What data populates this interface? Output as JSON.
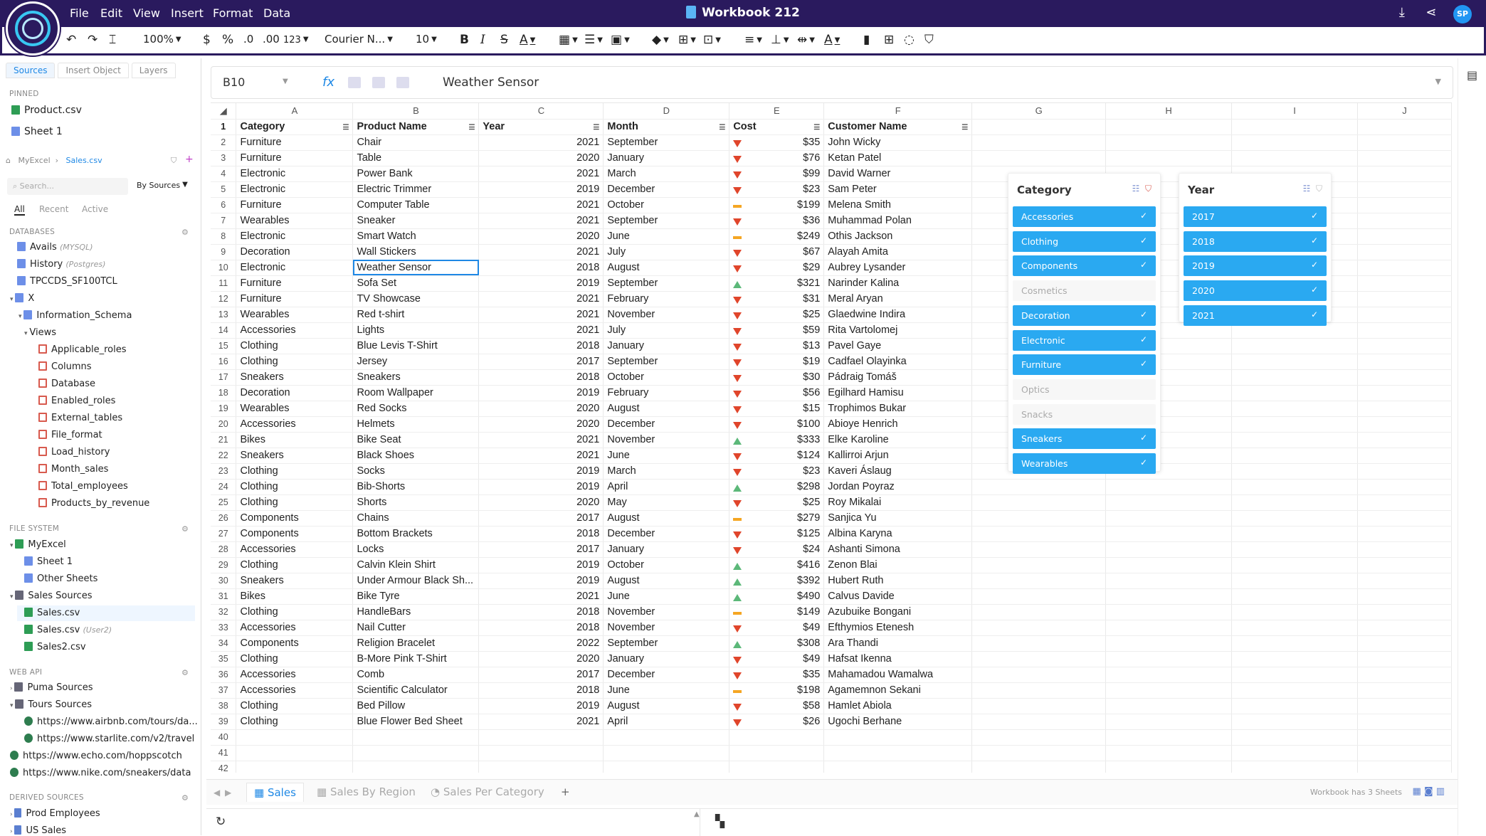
{
  "app": {
    "title": "Workbook 212",
    "menu": [
      "File",
      "Edit",
      "View",
      "Insert",
      "Format",
      "Data"
    ],
    "avatar_initials": "SP"
  },
  "toolbar": {
    "zoom": "100%",
    "currency": "$",
    "percent": "%",
    "dec_decrease": ".0",
    "dec_increase": ".00",
    "number_format": "123",
    "font": "Courier N...",
    "font_size": "10",
    "bold": "B",
    "italic": "I",
    "strike": "S",
    "text_color": "A",
    "font_color2": "A"
  },
  "sidebar": {
    "tabs": [
      "Sources",
      "Insert Object",
      "Layers"
    ],
    "pinned_label": "PINNED",
    "pinned": [
      "Product.csv",
      "Sheet 1"
    ],
    "breadcrumb": [
      "MyExcel",
      "Sales.csv"
    ],
    "search_placeholder": "Search...",
    "by_sources": "By Sources",
    "filter_tabs": [
      "All",
      "Recent",
      "Active"
    ],
    "databases_label": "DATABASES",
    "databases": [
      {
        "name": "Avails",
        "note": "(MYSQL)"
      },
      {
        "name": "History",
        "note": "(Postgres)"
      },
      {
        "name": "TPCCDS_SF100TCL",
        "note": ""
      },
      {
        "name": "X",
        "note": ""
      }
    ],
    "schema": "Information_Schema",
    "views_label": "Views",
    "views": [
      "Applicable_roles",
      "Columns",
      "Database",
      "Enabled_roles",
      "External_tables",
      "File_format",
      "Load_history",
      "Month_sales",
      "Total_employees",
      "Products_by_revenue"
    ],
    "file_system_label": "FILE SYSTEM",
    "file_system": {
      "root": "MyExcel",
      "children": [
        "Sheet 1",
        "Other Sheets"
      ],
      "folder": "Sales Sources",
      "files": [
        {
          "name": "Sales.csv",
          "note": ""
        },
        {
          "name": "Sales.csv",
          "note": "(User2)"
        },
        {
          "name": "Sales2.csv",
          "note": ""
        }
      ]
    },
    "web_api_label": "WEB API",
    "web_api": {
      "puma": "Puma Sources",
      "tours": "Tours Sources",
      "tour_links": [
        "https://www.airbnb.com/tours/da...",
        "https://www.starlite.com/v2/travel"
      ],
      "links": [
        "https://www.echo.com/hoppscotch",
        "https://www.nike.com/sneakers/data"
      ]
    },
    "derived_label": "DERIVED SOURCES",
    "derived": [
      "Prod Employees",
      "US Sales"
    ]
  },
  "formula_bar": {
    "cell_ref": "B10",
    "fx": "fx",
    "value": "Weather Sensor"
  },
  "grid": {
    "columns": [
      "A",
      "B",
      "C",
      "D",
      "E",
      "F",
      "G",
      "H",
      "I",
      "J"
    ],
    "headers": [
      "Category",
      "Product Name",
      "Year",
      "Month",
      "Cost",
      "Customer Name"
    ],
    "rows": [
      [
        "Furniture",
        "Chair",
        "2021",
        "September",
        "down",
        "$35",
        "John Wicky"
      ],
      [
        "Furniture",
        "Table",
        "2020",
        "January",
        "down",
        "$76",
        "Ketan Patel"
      ],
      [
        "Electronic",
        "Power Bank",
        "2021",
        "March",
        "down",
        "$99",
        "David Warner"
      ],
      [
        "Electronic",
        "Electric Trimmer",
        "2019",
        "December",
        "down",
        "$23",
        "Sam Peter"
      ],
      [
        "Furniture",
        "Computer Table",
        "2021",
        "October",
        "flat",
        "$199",
        "Melena Smith"
      ],
      [
        "Wearables",
        "Sneaker",
        "2021",
        "September",
        "down",
        "$36",
        "Muhammad Polan"
      ],
      [
        "Electronic",
        "Smart Watch",
        "2020",
        "June",
        "flat",
        "$249",
        "Othis Jackson"
      ],
      [
        "Decoration",
        "Wall Stickers",
        "2021",
        "July",
        "down",
        "$67",
        "Alayah Amita"
      ],
      [
        "Electronic",
        "Weather Sensor",
        "2018",
        "August",
        "down",
        "$29",
        "Aubrey Lysander"
      ],
      [
        "Furniture",
        "Sofa Set",
        "2019",
        "September",
        "up",
        "$321",
        "Narinder Kalina"
      ],
      [
        "Furniture",
        "TV Showcase",
        "2021",
        "February",
        "down",
        "$31",
        "Meral Aryan"
      ],
      [
        "Wearables",
        "Red t-shirt",
        "2021",
        "November",
        "down",
        "$25",
        "Glaedwine Indira"
      ],
      [
        "Accessories",
        "Lights",
        "2021",
        "July",
        "down",
        "$59",
        "Rita Vartolomej"
      ],
      [
        "Clothing",
        "Blue Levis T-Shirt",
        "2018",
        "January",
        "down",
        "$13",
        "Pavel Gaye"
      ],
      [
        "Clothing",
        "Jersey",
        "2017",
        "September",
        "down",
        "$19",
        "Cadfael Olayinka"
      ],
      [
        "Sneakers",
        "Sneakers",
        "2018",
        "October",
        "down",
        "$30",
        "Pádraig Tomáš"
      ],
      [
        "Decoration",
        "Room Wallpaper",
        "2019",
        "February",
        "down",
        "$56",
        "Egilhard Hamisu"
      ],
      [
        "Wearables",
        "Red Socks",
        "2020",
        "August",
        "down",
        "$15",
        "Trophimos Bukar"
      ],
      [
        "Accessories",
        "Helmets",
        "2020",
        "December",
        "down",
        "$100",
        "Abioye Henrich"
      ],
      [
        "Bikes",
        "Bike Seat",
        "2021",
        "November",
        "up",
        "$333",
        "Elke Karoline"
      ],
      [
        "Sneakers",
        "Black Shoes",
        "2021",
        "June",
        "down",
        "$124",
        "Kallirroi Arjun"
      ],
      [
        "Clothing",
        "Socks",
        "2019",
        "March",
        "down",
        "$23",
        "Kaveri Áslaug"
      ],
      [
        "Clothing",
        "Bib-Shorts",
        "2019",
        "April",
        "up",
        "$298",
        "Jordan Poyraz"
      ],
      [
        "Clothing",
        "Shorts",
        "2020",
        "May",
        "down",
        "$25",
        "Roy Mikalai"
      ],
      [
        "Components",
        "Chains",
        "2017",
        "August",
        "flat",
        "$279",
        "Sanjica Yu"
      ],
      [
        "Components",
        "Bottom Brackets",
        "2018",
        "December",
        "down",
        "$125",
        "Albina Karyna"
      ],
      [
        "Accessories",
        "Locks",
        "2017",
        "January",
        "down",
        "$24",
        "Ashanti Simona"
      ],
      [
        "Clothing",
        "Calvin Klein Shirt",
        "2019",
        "October",
        "up",
        "$416",
        "Zenon Blai"
      ],
      [
        "Sneakers",
        "Under Armour Black Sh...",
        "2019",
        "August",
        "up",
        "$392",
        "Hubert Ruth"
      ],
      [
        "Bikes",
        "Bike Tyre",
        "2021",
        "June",
        "up",
        "$490",
        "Calvus Davide"
      ],
      [
        "Clothing",
        "HandleBars",
        "2018",
        "November",
        "flat",
        "$149",
        "Azubuike Bongani"
      ],
      [
        "Accessories",
        "Nail Cutter",
        "2018",
        "November",
        "down",
        "$49",
        "Efthymios Etenesh"
      ],
      [
        "Components",
        "Religion Bracelet",
        "2022",
        "September",
        "up",
        "$308",
        "Ara Thandi"
      ],
      [
        "Clothing",
        "B-More Pink T-Shirt",
        "2020",
        "January",
        "down",
        "$49",
        "Hafsat Ikenna"
      ],
      [
        "Accessories",
        "Comb",
        "2017",
        "December",
        "down",
        "$35",
        "Mahamadou Wamalwa"
      ],
      [
        "Accessories",
        "Scientific Calculator",
        "2018",
        "June",
        "flat",
        "$198",
        "Agamemnon Sekani"
      ],
      [
        "Clothing",
        "Bed Pillow",
        "2019",
        "August",
        "down",
        "$58",
        "Hamlet Abiola"
      ],
      [
        "Clothing",
        "Blue Flower Bed Sheet",
        "2021",
        "April",
        "down",
        "$26",
        "Ugochi Berhane"
      ]
    ],
    "empty_rows": [
      40,
      41,
      42
    ],
    "selected_row": 10
  },
  "slicers": {
    "category": {
      "title": "Category",
      "items": [
        {
          "label": "Accessories",
          "on": true
        },
        {
          "label": "Clothing",
          "on": true
        },
        {
          "label": "Components",
          "on": true
        },
        {
          "label": "Cosmetics",
          "on": false
        },
        {
          "label": "Decoration",
          "on": true
        },
        {
          "label": "Electronic",
          "on": true
        },
        {
          "label": "Furniture",
          "on": true
        },
        {
          "label": "Optics",
          "on": false
        },
        {
          "label": "Snacks",
          "on": false
        },
        {
          "label": "Sneakers",
          "on": true
        },
        {
          "label": "Wearables",
          "on": true
        }
      ]
    },
    "year": {
      "title": "Year",
      "items": [
        {
          "label": "2017",
          "on": true
        },
        {
          "label": "2018",
          "on": true
        },
        {
          "label": "2019",
          "on": true
        },
        {
          "label": "2020",
          "on": true
        },
        {
          "label": "2021",
          "on": true
        }
      ]
    }
  },
  "sheet_tabs": {
    "tabs": [
      "Sales",
      "Sales By Region",
      "Sales Per Category"
    ],
    "add": "+",
    "note": "Workbook has 3 Sheets"
  },
  "colors": {
    "topbar": "#2a1a5e",
    "accent": "#1e88e5",
    "slicer_on": "#2aa9f1",
    "down": "#e0452b",
    "up": "#5cb879",
    "flat": "#f5a623"
  }
}
